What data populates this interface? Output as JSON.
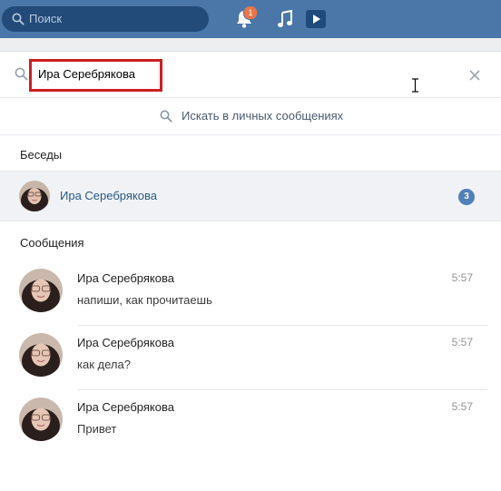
{
  "header": {
    "search_placeholder": "Поиск",
    "notifications_count": "1"
  },
  "search": {
    "query": "Ира Серебрякова",
    "private_messages_label": "Искать в личных сообщениях"
  },
  "conversations": {
    "title": "Беседы",
    "items": [
      {
        "name": "Ира Серебрякова",
        "unread": "3"
      }
    ]
  },
  "messages": {
    "title": "Сообщения",
    "items": [
      {
        "name": "Ира Серебрякова",
        "time": "5:57",
        "text": "напиши, как прочитаешь"
      },
      {
        "name": "Ира Серебрякова",
        "time": "5:57",
        "text": "как дела?"
      },
      {
        "name": "Ира Серебрякова",
        "time": "5:57",
        "text": "Привет"
      }
    ]
  },
  "colors": {
    "header_bg": "#4a76a8",
    "link": "#2a5885",
    "badge": "#5181b8",
    "notification_badge": "#e9754a",
    "highlight_frame": "#cc1f1f"
  },
  "icons": [
    "search-icon",
    "bell-icon",
    "music-icon",
    "video-icon",
    "close-icon",
    "text-cursor-icon"
  ]
}
